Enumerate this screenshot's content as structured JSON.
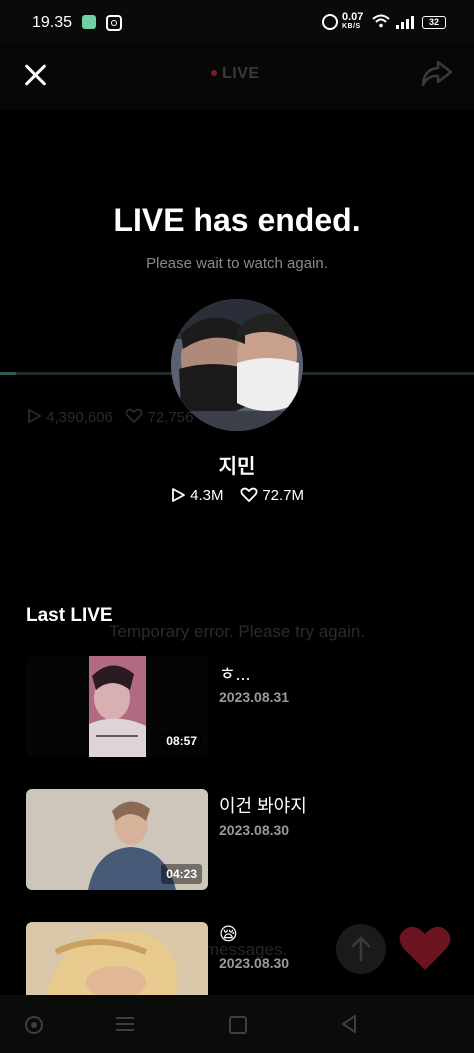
{
  "status_bar": {
    "time": "19.35",
    "speed_value": "0.07",
    "speed_unit": "KB/S",
    "battery": "32",
    "icons": [
      "chat-app-icon",
      "instagram-icon",
      "alarm-icon",
      "wifi-icon",
      "signal-icon",
      "battery-icon"
    ]
  },
  "header": {
    "live_label": "LIVE",
    "icons": [
      "close-icon",
      "share-icon"
    ]
  },
  "background": {
    "views": "4,390,606",
    "likes": "72,756",
    "error_text": "Temporary error. Please try again.",
    "messages_text": "messages."
  },
  "ended": {
    "title": "LIVE has ended.",
    "subtitle": "Please wait to watch again.",
    "artist_name": "지민",
    "views": "4.3M",
    "likes": "72.7M"
  },
  "last_live": {
    "section_title": "Last LIVE",
    "items": [
      {
        "title": "ㅎ...",
        "date": "2023.08.31",
        "duration": "08:57"
      },
      {
        "title": "이건 봐야지",
        "date": "2023.08.30",
        "duration": "04:23"
      },
      {
        "title": "😪",
        "date": "2023.08.30",
        "duration": ""
      }
    ]
  },
  "colors": {
    "background": "#000000",
    "live_dot": "#7a1f1f",
    "heart": "#6b1420"
  }
}
